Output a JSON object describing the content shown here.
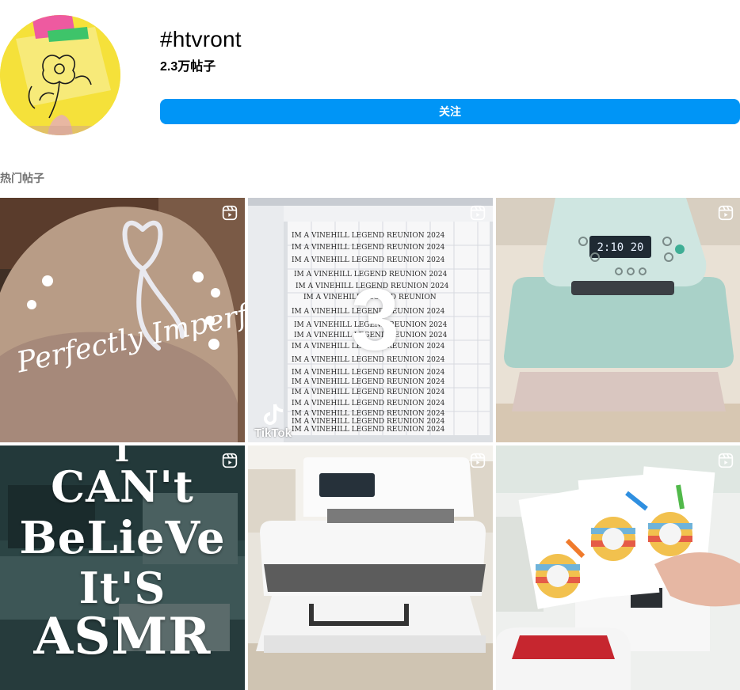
{
  "header": {
    "hashtag": "#htvront",
    "post_count": "2.3万帖子",
    "follow_label": "关注"
  },
  "section": {
    "top_posts_label": "热门帖子"
  },
  "posts": [
    {
      "kind": "image",
      "subject": "rhinestone cap",
      "reel": true
    },
    {
      "kind": "video",
      "subject": "cricut design space text layout",
      "reel": true,
      "overlay_number": "3",
      "watermark": "TikTok"
    },
    {
      "kind": "image",
      "subject": "heat press panel",
      "reel": true,
      "display_time": "2:10 20"
    },
    {
      "kind": "video",
      "subject": "asmr text",
      "reel": true,
      "lines": [
        "I",
        "CAN't",
        "BeLieVe",
        "It'S",
        "ASMR"
      ]
    },
    {
      "kind": "image",
      "subject": "auto heat press",
      "reel": true
    },
    {
      "kind": "image",
      "subject": "dog keychains",
      "reel": true
    }
  ],
  "colors": {
    "follow_bg": "#0095f6",
    "follow_text": "#ffffff",
    "section_label": "#737373"
  },
  "icons": {
    "reel": "reel-icon"
  }
}
